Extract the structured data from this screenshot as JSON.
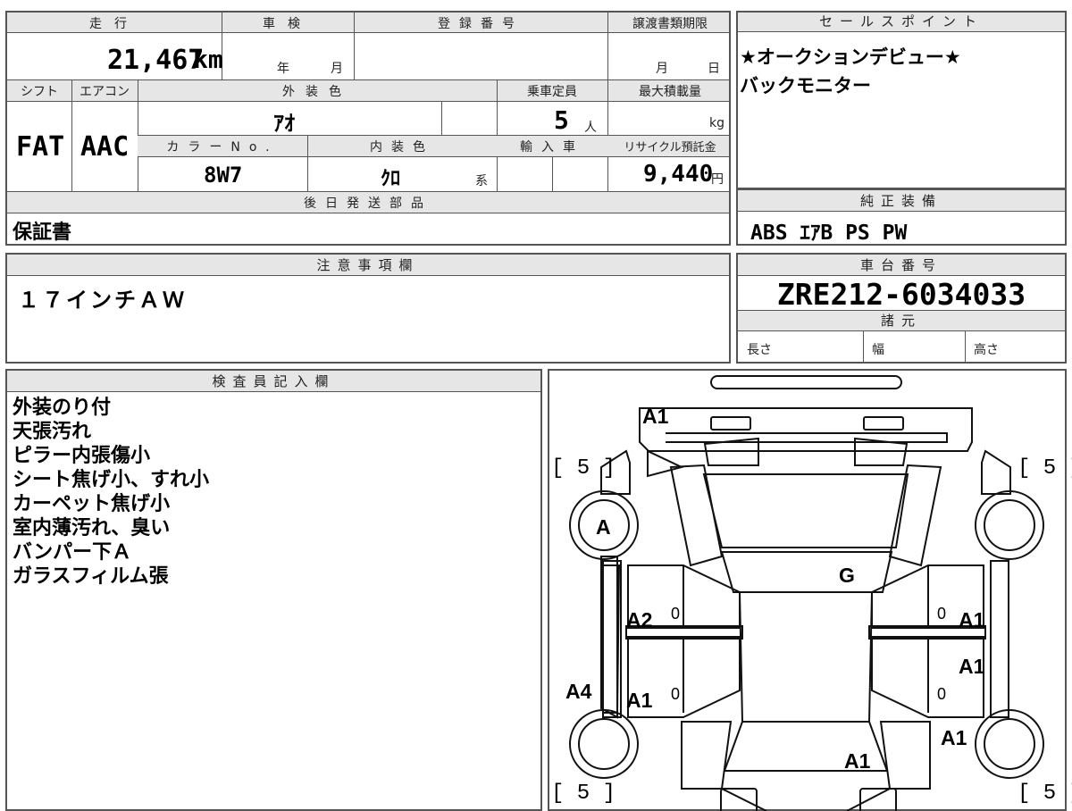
{
  "mileage": {
    "label": "走行",
    "value": "21,467",
    "unit": "km"
  },
  "inspection": {
    "label": "車検",
    "year": "年",
    "month": "月"
  },
  "registration": {
    "label": "登録番号",
    "value": ""
  },
  "transfer_deadline": {
    "label": "譲渡書類期限",
    "month": "月",
    "day": "日"
  },
  "shift": {
    "label": "シフト",
    "value": "FAT"
  },
  "aircon": {
    "label": "エアコン",
    "value": "AAC"
  },
  "exterior_color": {
    "label": "外装色",
    "value": "ｱｵ"
  },
  "capacity": {
    "label": "乗車定員",
    "value": "5",
    "unit": "人"
  },
  "max_load": {
    "label": "最大積載量",
    "unit": "kg"
  },
  "color_no": {
    "label": "カラーNo.",
    "value": "8W7"
  },
  "interior_color": {
    "label": "内装色",
    "value": "ｸﾛ",
    "suffix": "系"
  },
  "import": {
    "label": "輸入車"
  },
  "recycle_fee": {
    "label": "リサイクル預託金",
    "value": "9,440",
    "unit": "円"
  },
  "later_parts": {
    "label": "後日発送部品",
    "value": "保証書"
  },
  "sales_points": {
    "label": "セールスポイント",
    "lines": [
      "★オークションデビュー★",
      "バックモニター"
    ]
  },
  "equipment": {
    "label": "純正装備",
    "value": "ABS ｴｱB PS PW"
  },
  "notes": {
    "label": "注意事項欄",
    "value": "１７インチＡＷ"
  },
  "chassis": {
    "label": "車台番号",
    "value": "ZRE212-6034033"
  },
  "specs": {
    "label": "諸元",
    "length": "長さ",
    "width": "幅",
    "height": "高さ"
  },
  "inspector": {
    "label": "検査員記入欄",
    "lines": [
      "外装のり付",
      "天張汚れ",
      "ピラー内張傷小",
      "シート焦げ小、すれ小",
      "カーペット焦げ小",
      "室内薄汚れ、臭い",
      "バンパー下Ａ",
      "ガラスフィルム張"
    ]
  },
  "diagram": {
    "marks": {
      "front_bumper": "A1",
      "front_left_tire": "A",
      "hood_glass": "G",
      "left_front_door": "A2",
      "left_rear_door": "A1",
      "left_rocker": "A4",
      "right_front_door": "A1",
      "right_rear_door": "A1",
      "right_rear_fender": "A1",
      "trunk": "A1"
    },
    "tire_front_left": "[ 5 ]",
    "tire_front_right": "[ 5 ]",
    "tire_rear_left": "[ 5 ]",
    "tire_rear_right": "[ 5 ]",
    "zeros": [
      "0",
      "0",
      "0",
      "0"
    ]
  }
}
